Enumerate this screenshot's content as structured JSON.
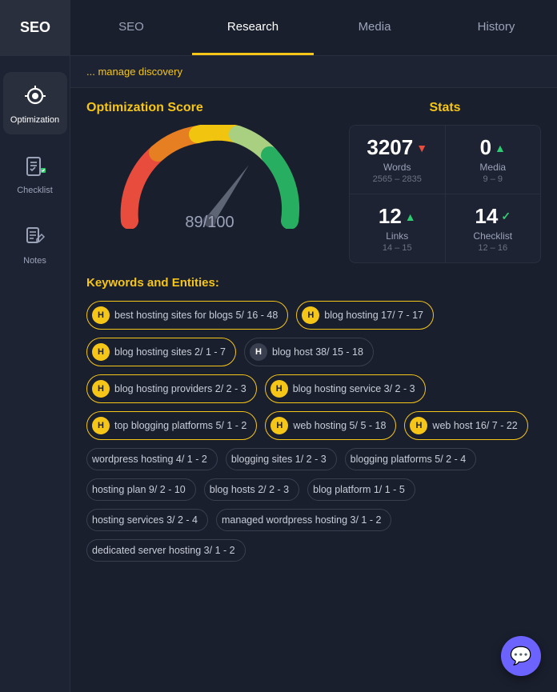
{
  "nav": {
    "logo": "SEO",
    "items": [
      {
        "id": "seo",
        "label": "SEO",
        "active": false
      },
      {
        "id": "research",
        "label": "Research",
        "active": true
      },
      {
        "id": "media",
        "label": "Media",
        "active": false
      },
      {
        "id": "history",
        "label": "History",
        "active": false
      }
    ]
  },
  "sidebar": {
    "items": [
      {
        "id": "optimization",
        "label": "Optimization",
        "active": true
      },
      {
        "id": "checklist",
        "label": "Checklist",
        "active": false
      },
      {
        "id": "notes",
        "label": "Notes",
        "active": false
      }
    ]
  },
  "breadcrumb": "... manage discovery",
  "optimization": {
    "title": "Optimization Score",
    "score": "89",
    "max": "/100"
  },
  "stats": {
    "title": "Stats",
    "cells": [
      {
        "id": "words",
        "value": "3207",
        "arrow": "down",
        "label": "Words",
        "range": "2565 – 2835"
      },
      {
        "id": "media",
        "value": "0",
        "arrow": "up",
        "label": "Media",
        "range": "9 – 9"
      },
      {
        "id": "links",
        "value": "12",
        "arrow": "up",
        "label": "Links",
        "range": "14 – 15"
      },
      {
        "id": "checklist",
        "value": "14",
        "arrow": "check",
        "label": "Checklist",
        "range": "12 – 16"
      }
    ]
  },
  "keywords": {
    "title": "Keywords and Entities:",
    "tags": [
      {
        "id": 1,
        "badge": "H",
        "badgeType": "yellow",
        "text": "best hosting sites for blogs 5/ 16 - 48",
        "highlighted": true
      },
      {
        "id": 2,
        "badge": "H",
        "badgeType": "yellow",
        "text": "blog hosting 17/ 7 - 17",
        "highlighted": true
      },
      {
        "id": 3,
        "badge": "H",
        "badgeType": "yellow",
        "text": "blog hosting sites 2/ 1 - 7",
        "highlighted": true
      },
      {
        "id": 4,
        "badge": "H",
        "badgeType": "dark",
        "text": "blog host 38/ 15 - 18",
        "highlighted": false
      },
      {
        "id": 5,
        "badge": "H",
        "badgeType": "yellow",
        "text": "blog hosting providers 2/ 2 - 3",
        "highlighted": true
      },
      {
        "id": 6,
        "badge": "H",
        "badgeType": "yellow",
        "text": "blog hosting service 3/ 2 - 3",
        "highlighted": true
      },
      {
        "id": 7,
        "badge": "H",
        "badgeType": "yellow",
        "text": "top blogging platforms 5/ 1 - 2",
        "highlighted": true
      },
      {
        "id": 8,
        "badge": "H",
        "badgeType": "yellow",
        "text": "web hosting 5/ 5 - 18",
        "highlighted": true
      },
      {
        "id": 9,
        "badge": "H",
        "badgeType": "yellow",
        "text": "web host 16/ 7 - 22",
        "highlighted": true
      },
      {
        "id": 10,
        "badge": null,
        "badgeType": null,
        "text": "wordpress hosting 4/ 1 - 2",
        "highlighted": false
      },
      {
        "id": 11,
        "badge": null,
        "badgeType": null,
        "text": "blogging sites 1/ 2 - 3",
        "highlighted": false
      },
      {
        "id": 12,
        "badge": null,
        "badgeType": null,
        "text": "blogging platforms 5/ 2 - 4",
        "highlighted": false
      },
      {
        "id": 13,
        "badge": null,
        "badgeType": null,
        "text": "hosting plan 9/ 2 - 10",
        "highlighted": false
      },
      {
        "id": 14,
        "badge": null,
        "badgeType": null,
        "text": "blog hosts 2/ 2 - 3",
        "highlighted": false
      },
      {
        "id": 15,
        "badge": null,
        "badgeType": null,
        "text": "blog platform 1/ 1 - 5",
        "highlighted": false
      },
      {
        "id": 16,
        "badge": null,
        "badgeType": null,
        "text": "hosting services 3/ 2 - 4",
        "highlighted": false
      },
      {
        "id": 17,
        "badge": null,
        "badgeType": null,
        "text": "managed wordpress hosting 3/ 1 - 2",
        "highlighted": false
      },
      {
        "id": 18,
        "badge": null,
        "badgeType": null,
        "text": "dedicated server hosting 3/ 1 - 2",
        "highlighted": false
      }
    ]
  },
  "chat_icon": "💬"
}
